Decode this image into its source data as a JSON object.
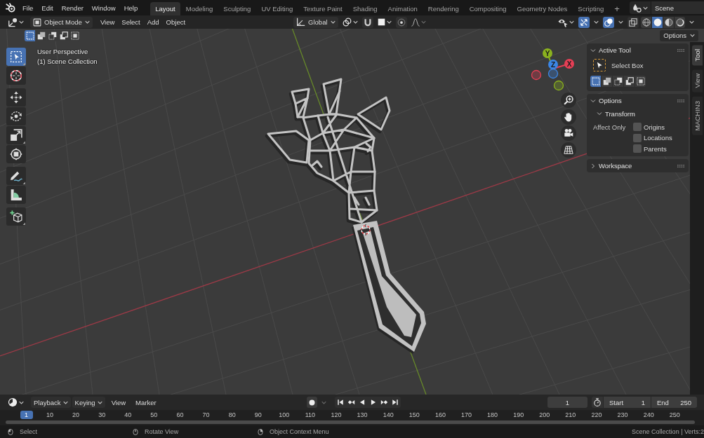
{
  "top_bar": {
    "menus": [
      "File",
      "Edit",
      "Render",
      "Window",
      "Help"
    ],
    "workspace_tabs": [
      {
        "label": "Layout",
        "selected": true
      },
      {
        "label": "Modeling",
        "selected": false
      },
      {
        "label": "Sculpting",
        "selected": false
      },
      {
        "label": "UV Editing",
        "selected": false
      },
      {
        "label": "Texture Paint",
        "selected": false
      },
      {
        "label": "Shading",
        "selected": false
      },
      {
        "label": "Animation",
        "selected": false
      },
      {
        "label": "Rendering",
        "selected": false
      },
      {
        "label": "Compositing",
        "selected": false
      },
      {
        "label": "Geometry Nodes",
        "selected": false
      },
      {
        "label": "Scripting",
        "selected": false
      }
    ],
    "add_workspace": "+",
    "scene": "Scene"
  },
  "viewport_header": {
    "mode": "Object Mode",
    "menus": [
      "View",
      "Select",
      "Add",
      "Object"
    ],
    "orientation": "Global",
    "snap": {
      "on": false
    },
    "proportional_editing": {
      "on": false
    },
    "gizmos": {
      "on": true
    },
    "overlays": {
      "on": true
    },
    "xray": {
      "on": false
    },
    "shading_modes": [
      {
        "kind": "wireframe",
        "selected": false
      },
      {
        "kind": "solid",
        "selected": true
      },
      {
        "kind": "material",
        "selected": false
      },
      {
        "kind": "rendered",
        "selected": false
      }
    ],
    "select_modes": [
      {
        "kind": "set",
        "selected": true
      },
      {
        "kind": "extend",
        "selected": false
      },
      {
        "kind": "subtract",
        "selected": false
      },
      {
        "kind": "invert",
        "selected": false
      },
      {
        "kind": "intersect",
        "selected": false
      }
    ],
    "options": "Options"
  },
  "toolbar": {
    "groups": [
      {
        "tools": [
          {
            "kind": "select_box",
            "selected": true,
            "variants": true
          },
          {
            "kind": "cursor",
            "selected": false,
            "variants": false
          }
        ]
      },
      {
        "tools": [
          {
            "kind": "move",
            "selected": false,
            "variants": false
          },
          {
            "kind": "rotate",
            "selected": false,
            "variants": false
          },
          {
            "kind": "scale",
            "selected": false,
            "variants": true
          },
          {
            "kind": "transform",
            "selected": false,
            "variants": false
          }
        ]
      },
      {
        "tools": [
          {
            "kind": "annotate",
            "selected": false,
            "variants": true
          },
          {
            "kind": "measure",
            "selected": false,
            "variants": false
          }
        ]
      },
      {
        "tools": [
          {
            "kind": "add_cube",
            "selected": false,
            "variants": true
          }
        ]
      }
    ]
  },
  "viewport": {
    "view_name": "User Perspective",
    "collection": "(1) Scene Collection",
    "axes": [
      {
        "label": "Y",
        "color": "#8bb21e"
      },
      {
        "label": "Z",
        "color": "#3b86e6"
      },
      {
        "label": "X",
        "color": "#e53f55"
      }
    ]
  },
  "sidebar": {
    "tabs": [
      {
        "label": "Tool",
        "selected": true
      },
      {
        "label": "View",
        "selected": false
      },
      {
        "label": "MACHIN3",
        "selected": false
      }
    ],
    "panels": [
      {
        "kind": "active_tool",
        "title": "Active Tool",
        "expanded": true,
        "tool": "Select Box",
        "select_modes": [
          {
            "kind": "set",
            "selected": true
          },
          {
            "kind": "extend",
            "selected": false
          },
          {
            "kind": "subtract",
            "selected": false
          },
          {
            "kind": "invert",
            "selected": false
          },
          {
            "kind": "intersect",
            "selected": false
          }
        ]
      },
      {
        "kind": "options",
        "title": "Options",
        "expanded": true,
        "subpanel": {
          "title": "Transform",
          "expanded": true,
          "label": "Affect Only",
          "checkboxes": [
            {
              "label": "Origins",
              "checked": false
            },
            {
              "label": "Locations",
              "checked": false
            },
            {
              "label": "Parents",
              "checked": false
            }
          ]
        }
      },
      {
        "kind": "workspace",
        "title": "Workspace",
        "expanded": false
      }
    ]
  },
  "timeline": {
    "editor_menus": [
      {
        "kind": "dropdown",
        "label": "Playback"
      },
      {
        "kind": "dropdown",
        "label": "Keying"
      },
      {
        "kind": "menu",
        "label": "View"
      },
      {
        "kind": "menu",
        "label": "Marker"
      }
    ],
    "auto_keying": {
      "on": false
    },
    "current_frame": "1",
    "start": {
      "label": "Start",
      "value": "1"
    },
    "end": {
      "label": "End",
      "value": "250"
    },
    "ruler": {
      "current": "1",
      "ticks": [
        "10",
        "20",
        "30",
        "40",
        "50",
        "60",
        "70",
        "80",
        "90",
        "100",
        "110",
        "120",
        "130",
        "140",
        "150",
        "160",
        "170",
        "180",
        "190",
        "200",
        "210",
        "220",
        "230",
        "240",
        "250"
      ]
    }
  },
  "status_bar": {
    "hints": [
      {
        "kind": "left_mouse",
        "label": "Select"
      },
      {
        "kind": "middle_mouse",
        "label": "Rotate View"
      },
      {
        "kind": "right_mouse",
        "label": "Object Context Menu"
      }
    ],
    "stats": "Scene Collection | Verts:2"
  }
}
